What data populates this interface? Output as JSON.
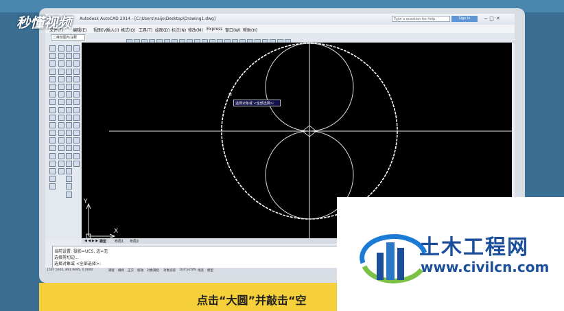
{
  "window": {
    "title": "Autodesk AutoCAD 2014 - [C:\\Users\\naijo\\Desktop\\Drawing1.dwg]",
    "help_placeholder": "Type a question for help",
    "signin_label": "Sign In"
  },
  "menu": [
    "文件(F)",
    "编辑(E)",
    "视图(V)",
    "插入(I)",
    "格式(O)",
    "工具(T)",
    "绘图(D)",
    "标注(N)",
    "修改(M)",
    "Express",
    "窗口(W)",
    "帮助(H)"
  ],
  "workspace": "二维草图与注释",
  "tooltip": "选择对象或 <全部选择>:",
  "tabs": [
    "模型",
    "布局1",
    "布局2"
  ],
  "command_lines": [
    "当前设置: 投影=UCS, 边=无",
    "选择剪切边...",
    "选择对象或 <全部选择>:"
  ],
  "status": {
    "coords": "1567.5602, 891.9695, 0.0000",
    "toggles": [
      "捕捉",
      "栅格",
      "正交",
      "极轴",
      "对象捕捉",
      "对象追踪",
      "DUCS",
      "DYN",
      "线宽",
      "模型"
    ]
  },
  "axes": {
    "x": "X",
    "y": "Y"
  },
  "caption": "点击“大圆”并敲击“空",
  "logo_tl": "秒懂视频",
  "watermark": {
    "name": "土木工程网",
    "url": "www.civilcn.com"
  },
  "colors": {
    "accent_yellow": "#f6d03a",
    "brand_blue": "#1b4f9c"
  }
}
